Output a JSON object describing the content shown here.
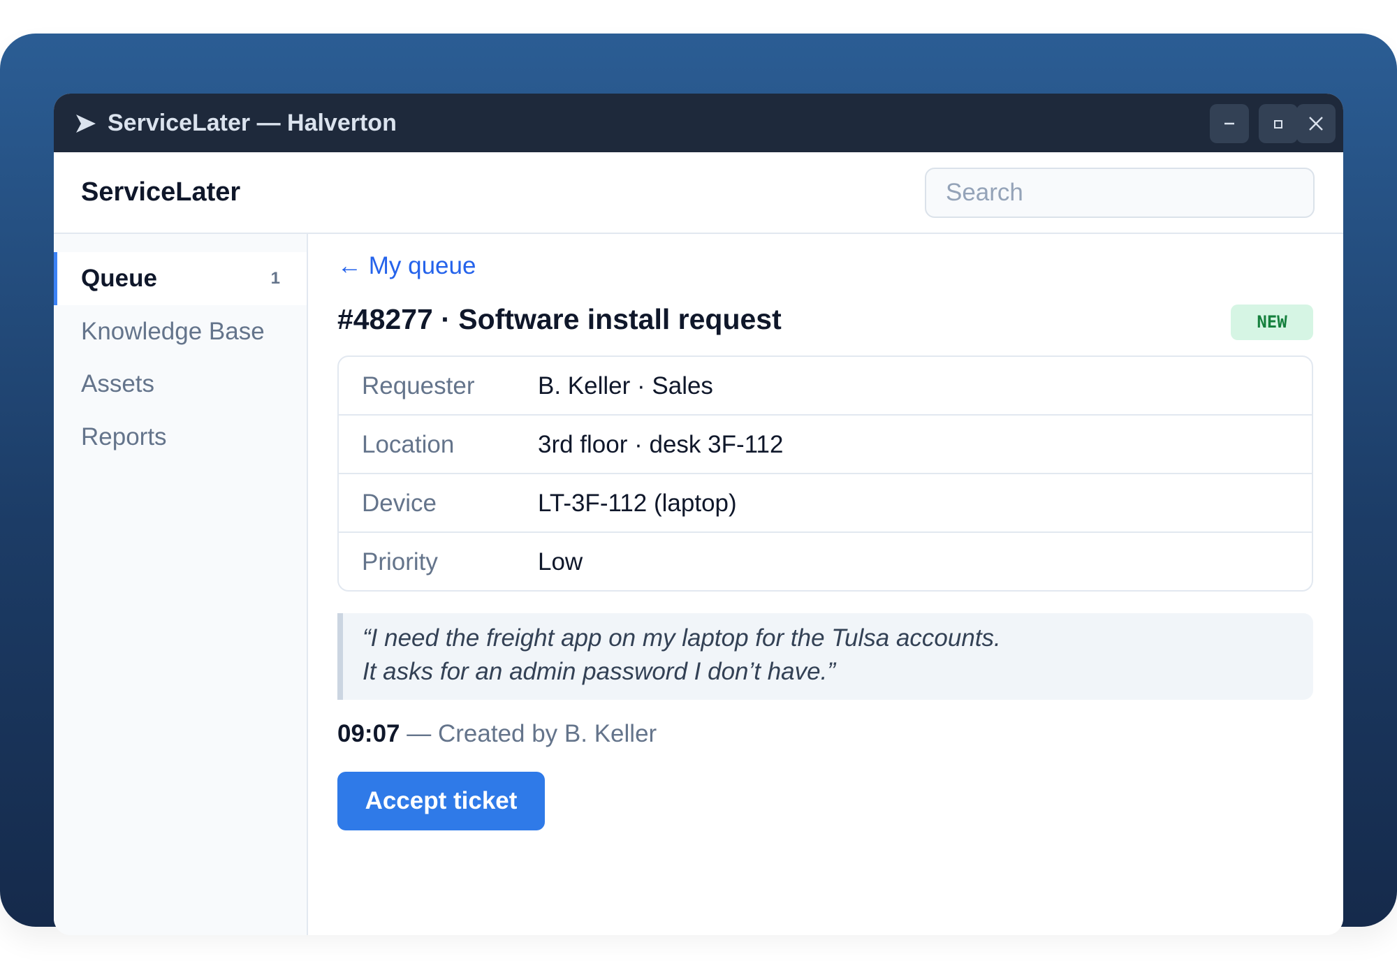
{
  "window": {
    "title": "ServiceLater — Halverton",
    "controls": [
      "minimize",
      "maximize",
      "close"
    ]
  },
  "header": {
    "brand": "ServiceLater",
    "search_placeholder": "Search"
  },
  "sidebar": {
    "items": [
      {
        "label": "Queue",
        "count": "1",
        "active": true
      },
      {
        "label": "Knowledge Base",
        "active": false
      },
      {
        "label": "Assets",
        "active": false
      },
      {
        "label": "Reports",
        "active": false
      }
    ]
  },
  "ticket": {
    "back_label": "← My queue",
    "title": "#48277 · Software install request",
    "status": "NEW",
    "details": [
      {
        "label": "Requester",
        "value": "B. Keller · Sales"
      },
      {
        "label": "Location",
        "value": "3rd floor · desk 3F-112"
      },
      {
        "label": "Device",
        "value": "LT-3F-112 (laptop)"
      },
      {
        "label": "Priority",
        "value": "Low"
      }
    ],
    "description": {
      "line1": "“I need the freight app on my laptop for the Tulsa accounts.",
      "line2": "It asks for an admin password I don’t have.”"
    },
    "activity": {
      "time": "09:07",
      "text": " — Created by B. Keller"
    },
    "action_label": "Accept ticket"
  },
  "colors": {
    "titlebar": "#1e293b",
    "accent": "#2f7ae8",
    "link": "#2563eb",
    "badge_bg": "#d6f5e4",
    "badge_text": "#15803d"
  }
}
